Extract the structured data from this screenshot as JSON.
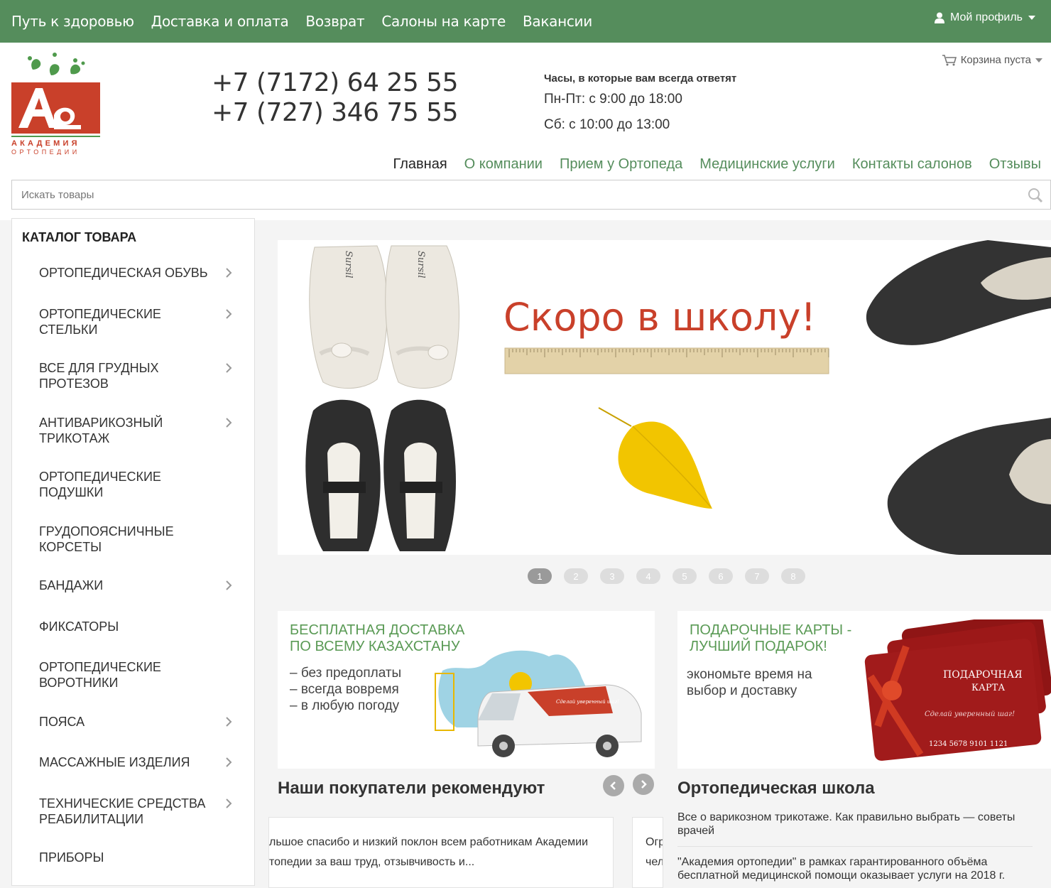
{
  "topbar": {
    "links": [
      "Путь к здоровью",
      "Доставка и оплата",
      "Возврат",
      "Салоны на карте",
      "Вакансии"
    ],
    "profile_label": "Мой профиль"
  },
  "header": {
    "logo_text_1": "АКАДЕМИЯ",
    "logo_text_2": "ОРТОПЕДИИ",
    "phones": [
      "+7 (7172) 64 25 55",
      "+7 (727) 346 75 55"
    ],
    "hours_title": "Часы, в которые вам всегда ответят",
    "hours_weekdays": "Пн-Пт: с 9:00 до 18:00",
    "hours_saturday": "Сб: с 10:00 до 13:00",
    "cart_label": "Корзина пуста"
  },
  "main_nav": [
    "Главная",
    "О компании",
    "Прием у Ортопеда",
    "Медицинские услуги",
    "Контакты салонов",
    "Отзывы"
  ],
  "search": {
    "placeholder": "Искать товары"
  },
  "catalog": {
    "title": "КАТАЛОГ ТОВАРА",
    "items": [
      {
        "label": "ОРТОПЕДИЧЕСКАЯ ОБУВЬ",
        "has_sub": true
      },
      {
        "label": "ОРТОПЕДИЧЕСКИЕ СТЕЛЬКИ",
        "has_sub": true
      },
      {
        "label": "ВСЕ ДЛЯ ГРУДНЫХ ПРОТЕЗОВ",
        "has_sub": true
      },
      {
        "label": "АНТИВАРИКОЗНЫЙ ТРИКОТАЖ",
        "has_sub": true
      },
      {
        "label": "ОРТОПЕДИЧЕСКИЕ ПОДУШКИ",
        "has_sub": false
      },
      {
        "label": "ГРУДОПОЯСНИЧНЫЕ КОРСЕТЫ",
        "has_sub": false
      },
      {
        "label": "БАНДАЖИ",
        "has_sub": true
      },
      {
        "label": "ФИКСАТОРЫ",
        "has_sub": false
      },
      {
        "label": "ОРТОПЕДИЧЕСКИЕ ВОРОТНИКИ",
        "has_sub": false
      },
      {
        "label": "ПОЯСА",
        "has_sub": true
      },
      {
        "label": "МАССАЖНЫЕ ИЗДЕЛИЯ",
        "has_sub": true
      },
      {
        "label": "ТЕХНИЧЕСКИЕ СРЕДСТВА РЕАБИЛИТАЦИИ",
        "has_sub": true
      },
      {
        "label": "ПРИБОРЫ",
        "has_sub": false
      }
    ]
  },
  "slider": {
    "headline": "Скоро в школу!",
    "brand": "Sursil",
    "pages": [
      "1",
      "2",
      "3",
      "4",
      "5",
      "6",
      "7",
      "8"
    ],
    "active_page": "1"
  },
  "promos": {
    "delivery": {
      "title_1": "БЕСПЛАТНАЯ ДОСТАВКА",
      "title_2": "ПО ВСЕМУ КАЗАХСТАНУ",
      "bullets": [
        "– без предоплаты",
        "– всегда вовремя",
        "– в любую погоду"
      ],
      "van_text": "Сделай уверенный шаг!"
    },
    "gift": {
      "title_1": "ПОДАРОЧНЫЕ КАРТЫ -",
      "title_2": "ЛУЧШИЙ ПОДАРОК!",
      "text_1": "экономьте время на",
      "text_2": "выбор и доставку",
      "card_title_1": "ПОДАРОЧНАЯ",
      "card_title_2": "КАРТА",
      "card_slogan": "Сделай уверенный шаг!",
      "card_number": "1234 5678 9101 1121"
    }
  },
  "reviews": {
    "title": "Наши покупатели рекомендуют",
    "items": [
      {
        "line1": "льшое спасибо и низкий поклон всем работникам Академии",
        "line2": "топедии за ваш труд, отзывчивость и..."
      },
      {
        "line1": "Огр",
        "line2": "чел"
      }
    ]
  },
  "school": {
    "title": "Ортопедическая школа",
    "articles": [
      "Все о варикозном трикотаже. Как правильно выбрать — советы врачей",
      "\"Академия ортопедии\" в рамках гарантированного объёма бесплатной медицинской помощи оказывает услуги на 2018 г."
    ]
  },
  "colors": {
    "brand_green": "#558d5c",
    "logo_red": "#c9402a",
    "promo_green": "#5a9a55",
    "gift_card_red": "#a11b1b"
  }
}
